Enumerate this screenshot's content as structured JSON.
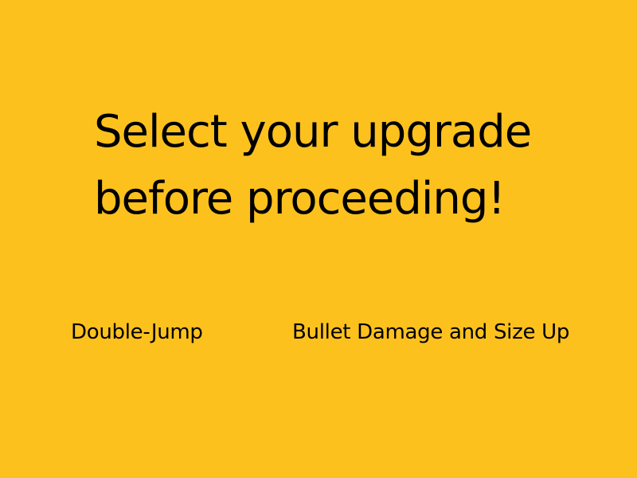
{
  "screen": {
    "background": "#FDC11E",
    "text_color": "#000000"
  },
  "prompt": {
    "lines": [
      "Select your upgrade",
      "before proceeding!"
    ]
  },
  "options": [
    {
      "label": "Double-Jump"
    },
    {
      "label": "Bullet Damage and Size Up"
    }
  ]
}
